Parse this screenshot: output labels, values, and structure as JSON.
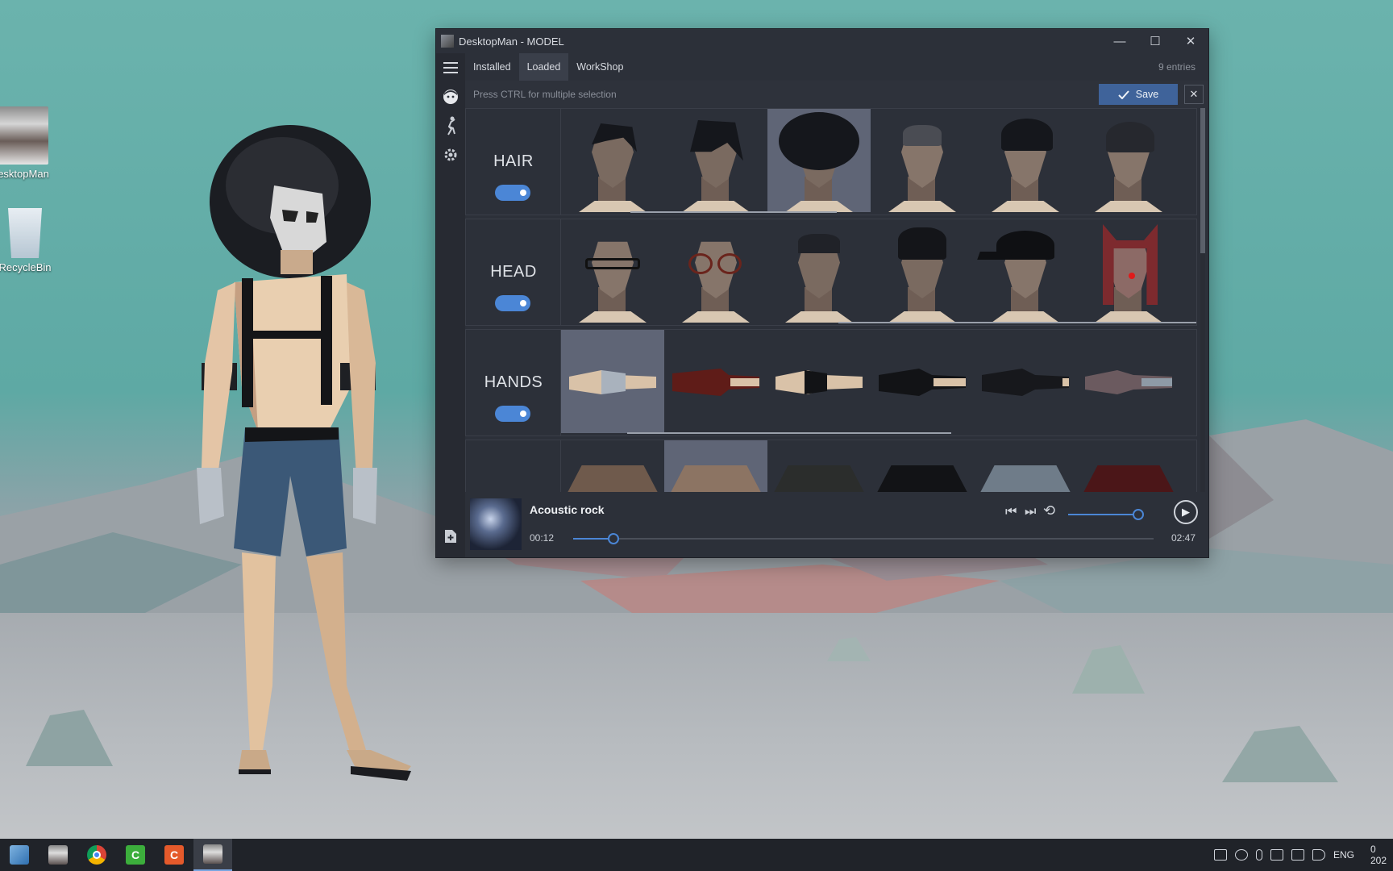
{
  "desktop": {
    "icons": [
      {
        "label": "esktopMan",
        "icon": "desktopman-app-icon"
      },
      {
        "label": "RecycleBin",
        "icon": "recycle-bin-icon"
      }
    ]
  },
  "window": {
    "title": "DesktopMan - MODEL",
    "controls": {
      "minimize": "—",
      "maximize": "☐",
      "close": "✕"
    },
    "sidebar": [
      "menu-icon",
      "face-icon",
      "dance-icon",
      "gear-icon",
      "add-file-icon"
    ],
    "tabs": [
      {
        "label": "Installed",
        "active": false
      },
      {
        "label": "Loaded",
        "active": true
      },
      {
        "label": "WorkShop",
        "active": false
      }
    ],
    "entries": "9 entries",
    "hint": "Press CTRL for multiple selection",
    "save_label": "Save",
    "close_panel": "✕",
    "categories": [
      {
        "name": "HAIR",
        "enabled": true,
        "selected_index": 2,
        "item_count": 6
      },
      {
        "name": "HEAD",
        "enabled": true,
        "selected_index": -1,
        "item_count": 6
      },
      {
        "name": "HANDS",
        "enabled": true,
        "selected_index": 0,
        "item_count": 6
      },
      {
        "name": "",
        "enabled": true,
        "selected_index": 1,
        "item_count": 6
      }
    ]
  },
  "player": {
    "track": "Acoustic rock",
    "elapsed": "00:12",
    "duration": "02:47",
    "progress": 0.07,
    "volume": 1.0,
    "controls": {
      "prev": "⏮",
      "next": "⏭",
      "repeat": "⟲",
      "play": "▶"
    }
  },
  "taskbar": {
    "apps": [
      {
        "icon": "tablet-icon",
        "active": false
      },
      {
        "icon": "desktopman-app-icon",
        "active": false
      },
      {
        "icon": "chrome-icon",
        "active": false
      },
      {
        "icon": "camtasia-green-icon",
        "active": false
      },
      {
        "icon": "camtasia-orange-icon",
        "active": false
      },
      {
        "icon": "desktopman-app-icon",
        "active": true
      }
    ],
    "language": "ENG",
    "clock_partial": "0",
    "date_partial": "202"
  },
  "colors": {
    "accent": "#4b86d6",
    "save": "#3f639a",
    "window_bg": "#2c3039"
  }
}
